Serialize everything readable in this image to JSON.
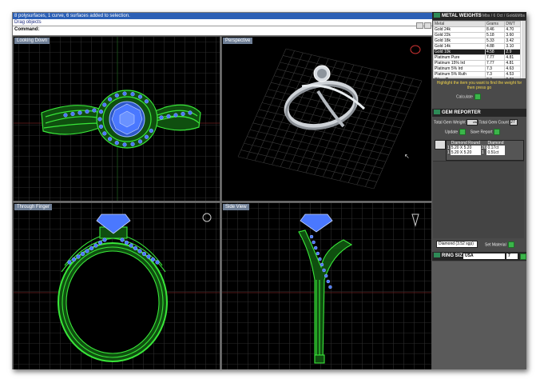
{
  "command": {
    "line1": "8 polysurfaces, 1 curve, 6 surfaces added to selection.",
    "line2": "Drag objects",
    "label": "Command:"
  },
  "viewports": {
    "top": "Looking Down",
    "perspective": "Perspective",
    "front": "Through Finger",
    "side": "Side View"
  },
  "metal_panel": {
    "title": "METAL WEIGHTS",
    "subtitle": "5.0 Mbs / 6 Oct / Gold&Mbs",
    "headers": [
      "Metal",
      "Grams",
      "DWT"
    ],
    "rows": [
      [
        "Gold 24k",
        "8.46",
        "4.70"
      ],
      [
        "Gold 22k",
        "5.18",
        "3.60"
      ],
      [
        "Gold 18k",
        "5.33",
        "3.42"
      ],
      [
        "Gold 14k",
        "4.88",
        "3.10"
      ],
      [
        "Gold 10k",
        "4.58",
        "2.9"
      ],
      [
        "Platinum Pure",
        "7.77",
        "4.81"
      ],
      [
        "Platinum 15% Ird",
        "7.77",
        "4.81"
      ],
      [
        "Platinum 5% Ird",
        "7.3",
        "4.63"
      ],
      [
        "Platinum 5% Ruth",
        "7.3",
        "4.53"
      ],
      [
        "Silver Pure",
        "3.8",
        "2.03"
      ],
      [
        "Silver Sterling 0.925",
        "3.47",
        "2.22"
      ]
    ],
    "note": "Highlight the item you want to find the weight for then press go",
    "calculate_label": "Calculate"
  },
  "gem_panel": {
    "title": "GEM REPORTER",
    "total_weight_label": "Total Gem Weight",
    "total_weight_value": "cts",
    "total_count_label": "Total Gem Count",
    "total_count_value": "27",
    "update_label": "Update",
    "save_report_label": "Save Report",
    "headers": [
      "",
      "Diamond Round",
      "",
      "Diamond"
    ],
    "rows": [
      [
        "1",
        "5.20 X 5.20",
        "26",
        "0.17ct"
      ],
      [
        "1",
        "5.20 X 5.20",
        "1",
        "0.51ct"
      ]
    ],
    "material_value": "Diamond (3.52 sgp)",
    "set_material_label": "Set Material"
  },
  "ring_panel": {
    "title": "RING SIZE",
    "region_value": "USA",
    "size_value": "7"
  },
  "colors": {
    "wire_green": "#39e639",
    "gem_blue": "#4a78ff",
    "grid": "#2c2c2c"
  }
}
